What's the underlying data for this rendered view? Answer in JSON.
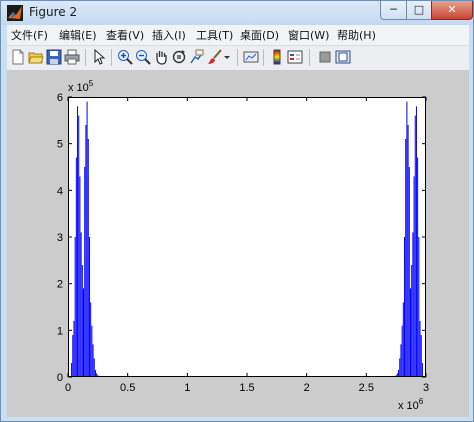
{
  "window": {
    "title": "Figure 2",
    "minimize_glyph": "─",
    "maximize_glyph": "□",
    "close_glyph": "✕"
  },
  "menubar": {
    "items": [
      "文件(F)",
      "编辑(E)",
      "查看(V)",
      "插入(I)",
      "工具(T)",
      "桌面(D)",
      "窗口(W)",
      "帮助(H)"
    ]
  },
  "toolbar": {
    "icons": [
      "new-figure-icon",
      "open-file-icon",
      "save-icon",
      "print-icon",
      "arrow-select-icon",
      "zoom-in-icon",
      "zoom-out-icon",
      "pan-hand-icon",
      "rotate-3d-icon",
      "data-cursor-icon",
      "brush-icon",
      "link-plot-icon",
      "colorbar-icon",
      "legend-icon",
      "hide-plot-tools-icon",
      "show-plot-tools-icon"
    ]
  },
  "colors": {
    "line": "#0000ff",
    "figure_bg": "#cccccc",
    "axes_bg": "#ffffff"
  },
  "chart_data": {
    "type": "line",
    "title": "",
    "xlabel": "",
    "ylabel": "",
    "xlim": [
      0,
      3000000
    ],
    "ylim": [
      0,
      600000
    ],
    "x_exponent": "x 10",
    "x_exponent_power": "6",
    "y_exponent": "x 10",
    "y_exponent_power": "5",
    "xticks": [
      "0",
      "0.5",
      "1",
      "1.5",
      "2",
      "2.5",
      "3"
    ],
    "yticks": [
      "0",
      "1",
      "2",
      "3",
      "4",
      "5",
      "6"
    ],
    "xtick_values": [
      0,
      500000,
      1000000,
      1500000,
      2000000,
      2500000,
      3000000
    ],
    "ytick_values": [
      0,
      100000,
      200000,
      300000,
      400000,
      500000,
      600000
    ],
    "grid": false,
    "series": [
      {
        "spikes_x": [
          30000,
          40000,
          50000,
          60000,
          70000,
          80000,
          90000,
          100000,
          110000,
          120000,
          130000,
          140000,
          150000,
          160000,
          170000,
          180000,
          190000,
          200000,
          210000,
          220000,
          230000,
          240000,
          250000,
          260000,
          2740000,
          2750000,
          2760000,
          2770000,
          2780000,
          2790000,
          2800000,
          2810000,
          2820000,
          2830000,
          2840000,
          2850000,
          2860000,
          2870000,
          2880000,
          2890000,
          2900000,
          2910000,
          2920000,
          2930000,
          2940000,
          2950000,
          2960000,
          2970000
        ],
        "spikes_y": [
          30000,
          90000,
          120000,
          300000,
          470000,
          580000,
          560000,
          430000,
          310000,
          240000,
          190000,
          450000,
          540000,
          590000,
          510000,
          300000,
          160000,
          110000,
          70000,
          40000,
          15000,
          8000,
          4000,
          2000,
          2000,
          4000,
          8000,
          15000,
          40000,
          70000,
          110000,
          160000,
          300000,
          510000,
          590000,
          540000,
          450000,
          190000,
          240000,
          310000,
          430000,
          560000,
          580000,
          470000,
          300000,
          120000,
          90000,
          30000
        ]
      }
    ]
  }
}
